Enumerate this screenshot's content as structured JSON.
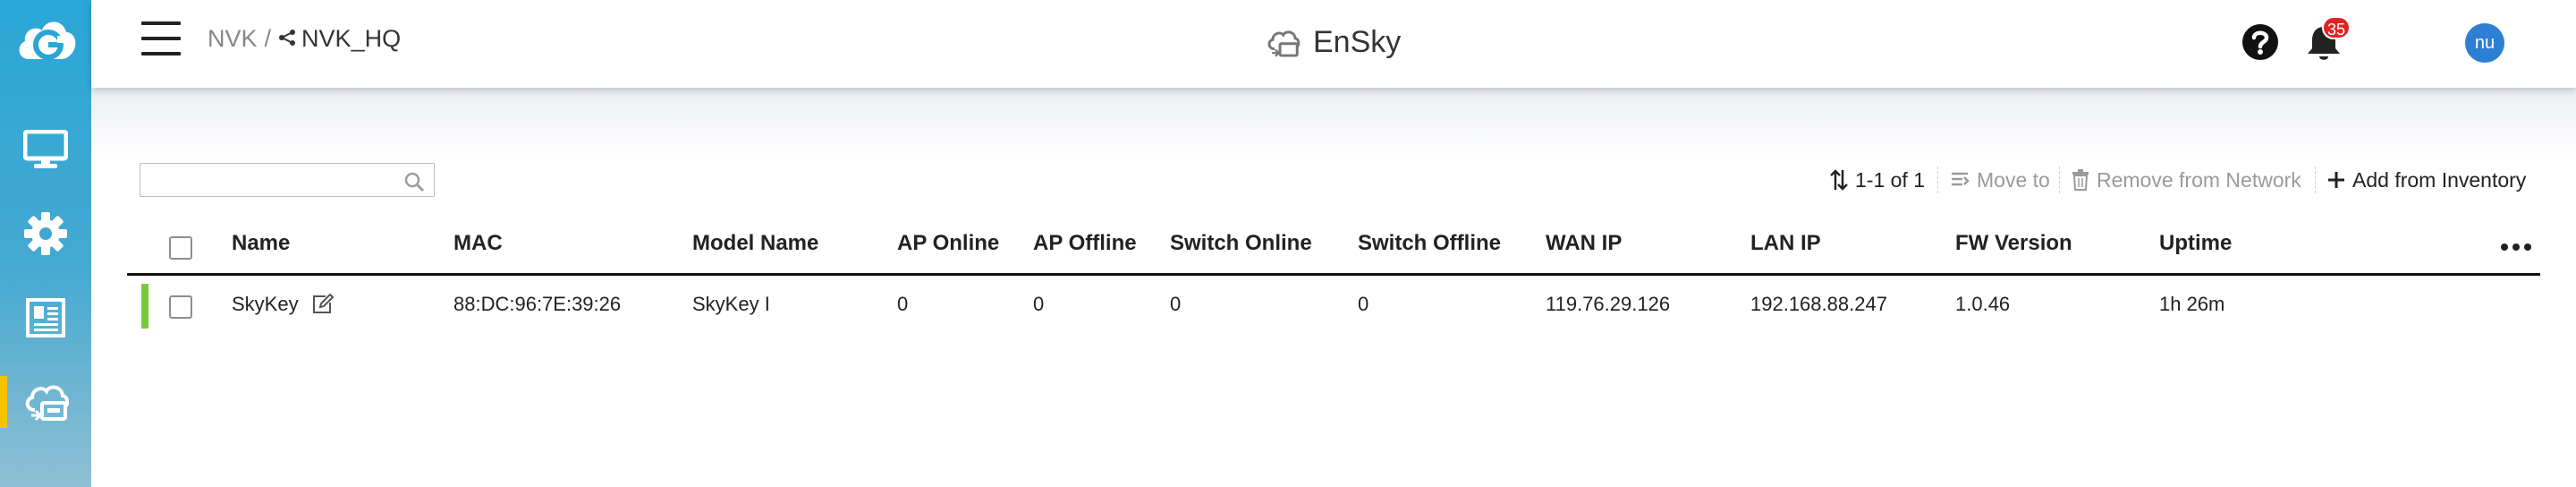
{
  "sidebar": {
    "items": [
      {
        "icon": "monitor-icon"
      },
      {
        "icon": "gear-icon"
      },
      {
        "icon": "report-icon"
      },
      {
        "icon": "cloud-device-icon",
        "active": true
      }
    ],
    "active_color": "#f5c300"
  },
  "header": {
    "breadcrumb_root": "NVK",
    "breadcrumb_sep": "/",
    "breadcrumb_current": "NVK_HQ",
    "app_title": "EnSky",
    "notification_count": "35",
    "avatar_initials": "nu"
  },
  "toolbar": {
    "search_placeholder": "",
    "pagination": "1-1 of 1",
    "move_to": "Move to",
    "remove_from_network": "Remove from Network",
    "add_from_inventory": "Add from Inventory"
  },
  "table": {
    "columns": [
      "Name",
      "MAC",
      "Model Name",
      "AP Online",
      "AP Offline",
      "Switch Online",
      "Switch Offline",
      "WAN IP",
      "LAN IP",
      "FW Version",
      "Uptime"
    ],
    "rows": [
      {
        "name": "SkyKey",
        "mac": "88:DC:96:7E:39:26",
        "model": "SkyKey I",
        "ap_online": "0",
        "ap_offline": "0",
        "switch_online": "0",
        "switch_offline": "0",
        "wan_ip": "119.76.29.126",
        "lan_ip": "192.168.88.247",
        "fw_version": "1.0.46",
        "uptime": "1h 26m",
        "status_color": "#78c93a"
      }
    ]
  }
}
